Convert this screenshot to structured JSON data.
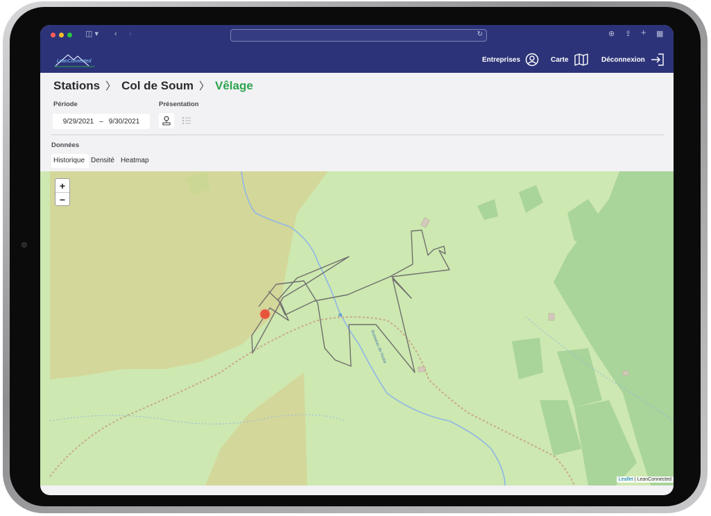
{
  "brand": {
    "logo_text": "LeanConnected"
  },
  "nav": {
    "enterprises": "Entreprises",
    "map": "Carte",
    "logout": "Déconnexion"
  },
  "breadcrumb": [
    "Stations",
    "Col de Soum",
    "Vêlage"
  ],
  "filters": {
    "period_label": "Période",
    "date_start": "9/29/2021",
    "date_separator": "–",
    "date_end": "9/30/2021",
    "presentation_label": "Présentation"
  },
  "data_section": {
    "label": "Données",
    "tabs": [
      "Historique",
      "Densité",
      "Heatmap"
    ],
    "active_tab": "Historique"
  },
  "map": {
    "zoom_in": "+",
    "zoom_out": "−",
    "stream_label": "Ruisseau de Hosta",
    "attribution_link": "Leaflet",
    "attribution_text": " | LeanConnected"
  },
  "colors": {
    "brand_navy": "#2c3378",
    "active_green": "#2da44e",
    "track_gray": "#6e6e6e",
    "marker_red": "#e5553b",
    "map_meadow": "#cde8b0",
    "map_forest": "#a9d49a",
    "map_scrub": "#d4d79a"
  },
  "icons": [
    "user-circle-icon",
    "map-icon",
    "logout-icon",
    "map-pin-icon",
    "list-icon"
  ]
}
